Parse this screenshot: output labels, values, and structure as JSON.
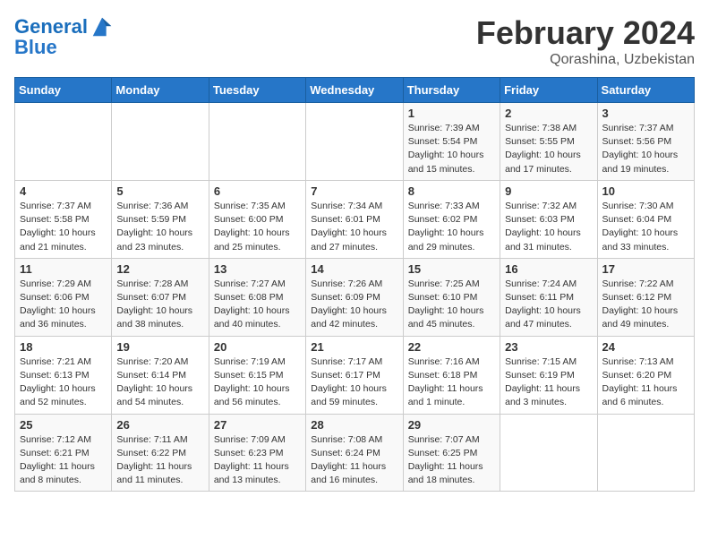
{
  "header": {
    "logo_line1": "General",
    "logo_line2": "Blue",
    "month": "February 2024",
    "location": "Qorashina, Uzbekistan"
  },
  "weekdays": [
    "Sunday",
    "Monday",
    "Tuesday",
    "Wednesday",
    "Thursday",
    "Friday",
    "Saturday"
  ],
  "weeks": [
    [
      {
        "day": "",
        "info": ""
      },
      {
        "day": "",
        "info": ""
      },
      {
        "day": "",
        "info": ""
      },
      {
        "day": "",
        "info": ""
      },
      {
        "day": "1",
        "info": "Sunrise: 7:39 AM\nSunset: 5:54 PM\nDaylight: 10 hours\nand 15 minutes."
      },
      {
        "day": "2",
        "info": "Sunrise: 7:38 AM\nSunset: 5:55 PM\nDaylight: 10 hours\nand 17 minutes."
      },
      {
        "day": "3",
        "info": "Sunrise: 7:37 AM\nSunset: 5:56 PM\nDaylight: 10 hours\nand 19 minutes."
      }
    ],
    [
      {
        "day": "4",
        "info": "Sunrise: 7:37 AM\nSunset: 5:58 PM\nDaylight: 10 hours\nand 21 minutes."
      },
      {
        "day": "5",
        "info": "Sunrise: 7:36 AM\nSunset: 5:59 PM\nDaylight: 10 hours\nand 23 minutes."
      },
      {
        "day": "6",
        "info": "Sunrise: 7:35 AM\nSunset: 6:00 PM\nDaylight: 10 hours\nand 25 minutes."
      },
      {
        "day": "7",
        "info": "Sunrise: 7:34 AM\nSunset: 6:01 PM\nDaylight: 10 hours\nand 27 minutes."
      },
      {
        "day": "8",
        "info": "Sunrise: 7:33 AM\nSunset: 6:02 PM\nDaylight: 10 hours\nand 29 minutes."
      },
      {
        "day": "9",
        "info": "Sunrise: 7:32 AM\nSunset: 6:03 PM\nDaylight: 10 hours\nand 31 minutes."
      },
      {
        "day": "10",
        "info": "Sunrise: 7:30 AM\nSunset: 6:04 PM\nDaylight: 10 hours\nand 33 minutes."
      }
    ],
    [
      {
        "day": "11",
        "info": "Sunrise: 7:29 AM\nSunset: 6:06 PM\nDaylight: 10 hours\nand 36 minutes."
      },
      {
        "day": "12",
        "info": "Sunrise: 7:28 AM\nSunset: 6:07 PM\nDaylight: 10 hours\nand 38 minutes."
      },
      {
        "day": "13",
        "info": "Sunrise: 7:27 AM\nSunset: 6:08 PM\nDaylight: 10 hours\nand 40 minutes."
      },
      {
        "day": "14",
        "info": "Sunrise: 7:26 AM\nSunset: 6:09 PM\nDaylight: 10 hours\nand 42 minutes."
      },
      {
        "day": "15",
        "info": "Sunrise: 7:25 AM\nSunset: 6:10 PM\nDaylight: 10 hours\nand 45 minutes."
      },
      {
        "day": "16",
        "info": "Sunrise: 7:24 AM\nSunset: 6:11 PM\nDaylight: 10 hours\nand 47 minutes."
      },
      {
        "day": "17",
        "info": "Sunrise: 7:22 AM\nSunset: 6:12 PM\nDaylight: 10 hours\nand 49 minutes."
      }
    ],
    [
      {
        "day": "18",
        "info": "Sunrise: 7:21 AM\nSunset: 6:13 PM\nDaylight: 10 hours\nand 52 minutes."
      },
      {
        "day": "19",
        "info": "Sunrise: 7:20 AM\nSunset: 6:14 PM\nDaylight: 10 hours\nand 54 minutes."
      },
      {
        "day": "20",
        "info": "Sunrise: 7:19 AM\nSunset: 6:15 PM\nDaylight: 10 hours\nand 56 minutes."
      },
      {
        "day": "21",
        "info": "Sunrise: 7:17 AM\nSunset: 6:17 PM\nDaylight: 10 hours\nand 59 minutes."
      },
      {
        "day": "22",
        "info": "Sunrise: 7:16 AM\nSunset: 6:18 PM\nDaylight: 11 hours\nand 1 minute."
      },
      {
        "day": "23",
        "info": "Sunrise: 7:15 AM\nSunset: 6:19 PM\nDaylight: 11 hours\nand 3 minutes."
      },
      {
        "day": "24",
        "info": "Sunrise: 7:13 AM\nSunset: 6:20 PM\nDaylight: 11 hours\nand 6 minutes."
      }
    ],
    [
      {
        "day": "25",
        "info": "Sunrise: 7:12 AM\nSunset: 6:21 PM\nDaylight: 11 hours\nand 8 minutes."
      },
      {
        "day": "26",
        "info": "Sunrise: 7:11 AM\nSunset: 6:22 PM\nDaylight: 11 hours\nand 11 minutes."
      },
      {
        "day": "27",
        "info": "Sunrise: 7:09 AM\nSunset: 6:23 PM\nDaylight: 11 hours\nand 13 minutes."
      },
      {
        "day": "28",
        "info": "Sunrise: 7:08 AM\nSunset: 6:24 PM\nDaylight: 11 hours\nand 16 minutes."
      },
      {
        "day": "29",
        "info": "Sunrise: 7:07 AM\nSunset: 6:25 PM\nDaylight: 11 hours\nand 18 minutes."
      },
      {
        "day": "",
        "info": ""
      },
      {
        "day": "",
        "info": ""
      }
    ]
  ]
}
